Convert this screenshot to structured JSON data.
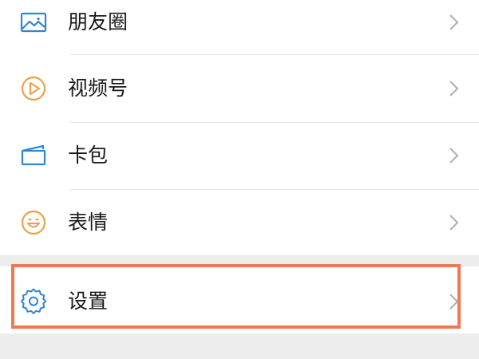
{
  "menu": {
    "items": [
      {
        "label": "朋友圈",
        "icon": "moments-icon",
        "icon_color": "#2f86d4"
      },
      {
        "label": "视频号",
        "icon": "channels-icon",
        "icon_color": "#e8a34a"
      },
      {
        "label": "卡包",
        "icon": "card-wallet-icon",
        "icon_color": "#2f86d4"
      },
      {
        "label": "表情",
        "icon": "sticker-icon",
        "icon_color": "#e8a34a"
      }
    ],
    "settings": {
      "label": "设置",
      "icon": "gear-icon",
      "icon_color": "#2f86d4"
    }
  },
  "colors": {
    "background": "#ededed",
    "row_background": "#ffffff",
    "chevron": "#b2b2b2",
    "highlight_border": "#ef7a52"
  }
}
